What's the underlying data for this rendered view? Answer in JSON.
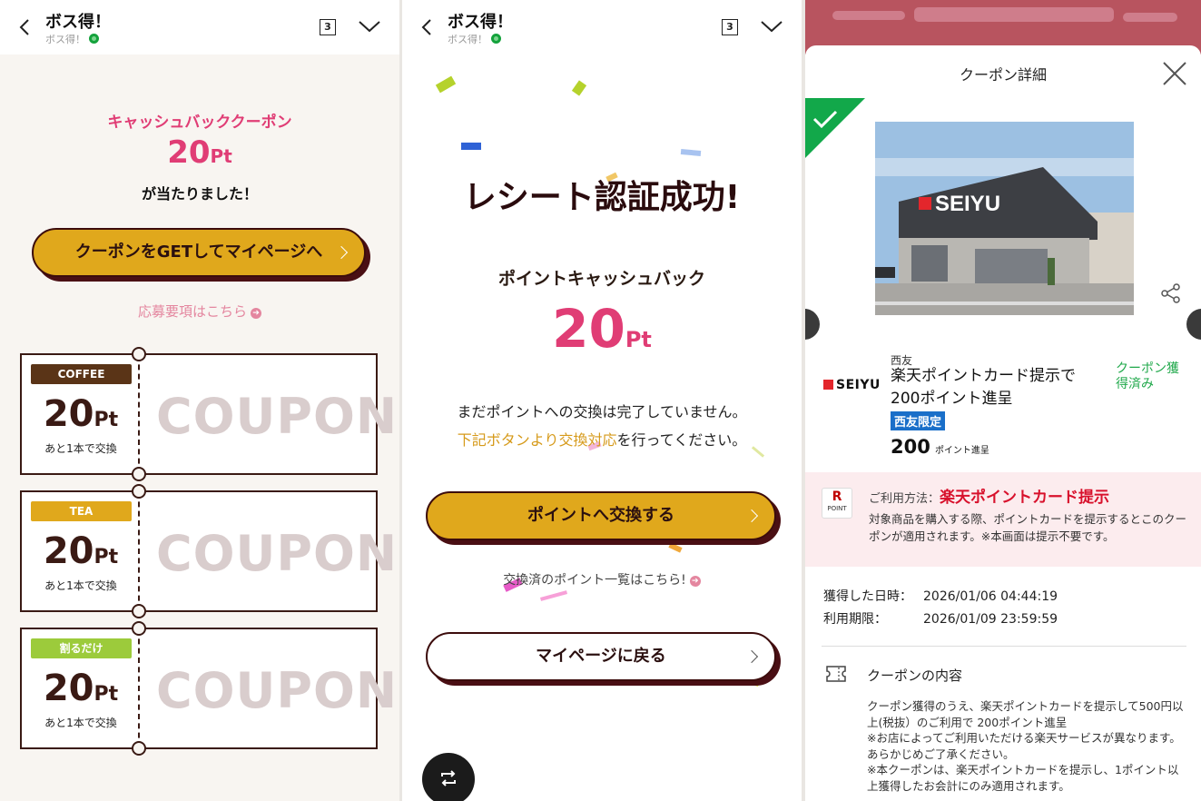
{
  "header": {
    "title": "ボス得！",
    "subtitle": "ボス得！",
    "tab_count": "3"
  },
  "panel1": {
    "title": "キャッシュバッククーポン",
    "points_value": "20",
    "points_unit": "Pt",
    "won_text": "が当たりました！",
    "button_label": "クーポンをGETしてマイページへ",
    "link_text": "応募要項はこちら",
    "tickets": [
      {
        "tag": "COFFEE",
        "tag_color": "#5a3417",
        "points": "20",
        "unit": "Pt",
        "remain": "あと1本で交換",
        "coupon": "COUPON"
      },
      {
        "tag": "TEA",
        "tag_color": "#e0a81c",
        "points": "20",
        "unit": "Pt",
        "remain": "あと1本で交換",
        "coupon": "COUPON"
      },
      {
        "tag": "割るだけ",
        "tag_color": "#9ccb3b",
        "points": "20",
        "unit": "Pt",
        "remain": "あと1本で交換",
        "coupon": "COUPON"
      }
    ]
  },
  "panel2": {
    "title": "レシート認証成功!",
    "subtitle": "ポイントキャッシュバック",
    "points_value": "20",
    "points_unit": "Pt",
    "message_line1": "まだポイントへの交換は完了していません。",
    "message_highlight": "下記ボタンより交換対応",
    "message_rest": "を行ってください。",
    "exchange_button": "ポイントへ交換する",
    "list_link": "交換済のポイント一覧はこちら!",
    "back_button": "マイページに戻る"
  },
  "panel3": {
    "sheet_title": "クーポン詳細",
    "photo_sign": "SEIYU",
    "brand_logo": "SEIYU",
    "store": "西友",
    "coupon_name": "楽天ポイントカード提示で200ポイント進呈",
    "limited_badge": "西友限定",
    "points": "200",
    "points_unit": "ポイント進呈",
    "status": "クーポン獲得済み",
    "usage_logo_letter": "R",
    "usage_logo_text": "POINT",
    "usage_label": "ご利用方法：",
    "usage_method": "楽天ポイントカード提示",
    "usage_desc": "対象商品を購入する際、ポイントカードを提示するとこのクーポンが適用されます。※本画面は提示不要です。",
    "acquired_label": "獲得した日時：",
    "acquired_value": "2026/01/06 04:44:19",
    "expiry_label": "利用期限：",
    "expiry_value": "2026/01/09 23:59:59",
    "content_heading": "クーポンの内容",
    "content_body": "クーポン獲得のうえ、楽天ポイントカードを提示して500円以上(税抜）のご利用で 200ポイント進呈\n※お店によってご利用いただける楽天サービスが異なります。あらかじめご了承ください。\n※本クーポンは、楽天ポイントカードを提示し、1ポイント以上獲得したお会計にのみ適用されます。"
  },
  "colors": {
    "pink": "#e03d75",
    "gold": "#e0a81c",
    "dark_brown": "#3c0c0c",
    "green": "#12a84a",
    "red": "#d8112c"
  }
}
